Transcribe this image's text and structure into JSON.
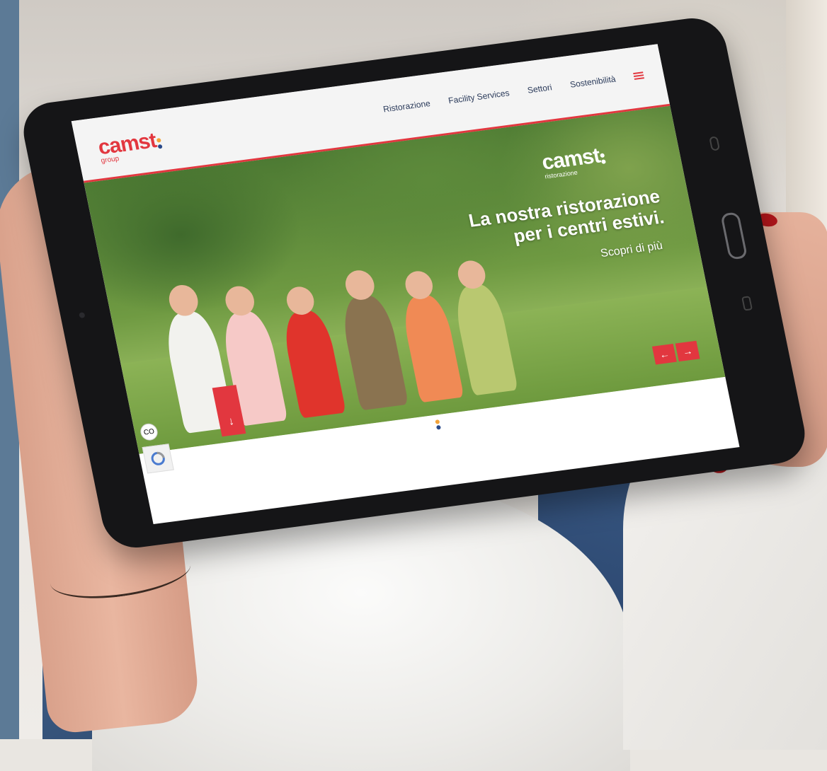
{
  "site": {
    "logo": {
      "word": "camst",
      "sub": "group"
    },
    "nav": [
      "Ristorazione",
      "Facility Services",
      "Settori",
      "Sostenibilità"
    ],
    "hero": {
      "logo_word": "camst",
      "logo_sub": "ristorazione",
      "title_line1": "La nostra ristorazione",
      "title_line2": "per i centri estivi.",
      "cta": "Scopri di più"
    },
    "arrows": {
      "prev": "←",
      "next": "→"
    },
    "scroll_down": "↓",
    "cookie_label": "CO"
  },
  "colors": {
    "brand_red": "#e2373f",
    "nav_text": "#2a3a5a",
    "logo_dot_orange": "#f2a33a",
    "logo_dot_blue": "#2a4a8a"
  },
  "icons": [
    "menu-icon",
    "arrow-left-icon",
    "arrow-right-icon",
    "arrow-down-icon",
    "cookie-icon",
    "recaptcha-icon"
  ]
}
